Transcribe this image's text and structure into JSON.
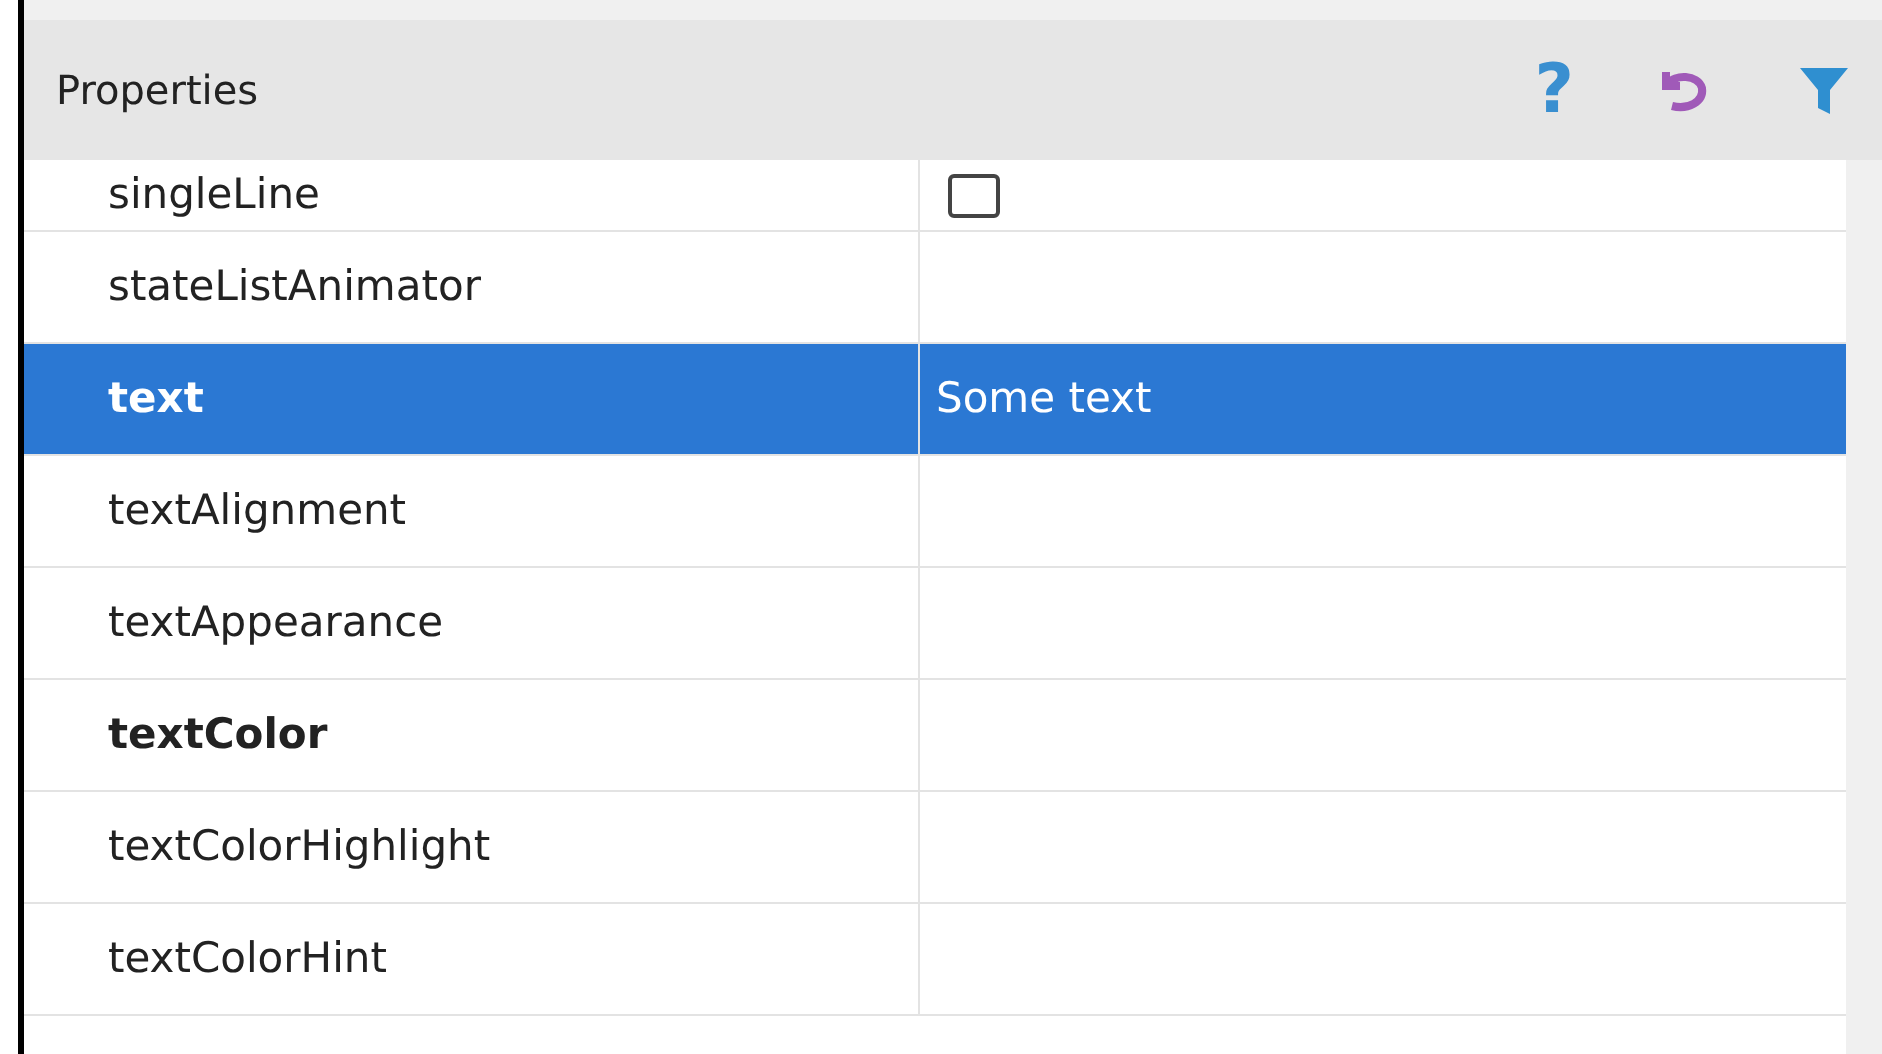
{
  "panel": {
    "title": "Properties"
  },
  "toolbar": [
    {
      "kind": "help",
      "label": "?"
    },
    {
      "kind": "undo"
    },
    {
      "kind": "filter"
    }
  ],
  "rows": [
    {
      "name": "singleLine",
      "kind": "checkbox",
      "checked": false,
      "modified": false,
      "selected": false
    },
    {
      "name": "stateListAnimator",
      "kind": "text",
      "modified": false,
      "selected": false
    },
    {
      "name": "text",
      "kind": "text",
      "value": "Some text",
      "modified": true,
      "selected": true
    },
    {
      "name": "textAlignment",
      "kind": "text",
      "modified": false,
      "selected": false
    },
    {
      "name": "textAppearance",
      "kind": "text",
      "modified": false,
      "selected": false
    },
    {
      "name": "textColor",
      "kind": "text",
      "modified": true,
      "selected": false
    },
    {
      "name": "textColorHighlight",
      "kind": "text",
      "modified": false,
      "selected": false
    },
    {
      "name": "textColorHint",
      "kind": "text",
      "modified": false,
      "selected": false
    }
  ]
}
